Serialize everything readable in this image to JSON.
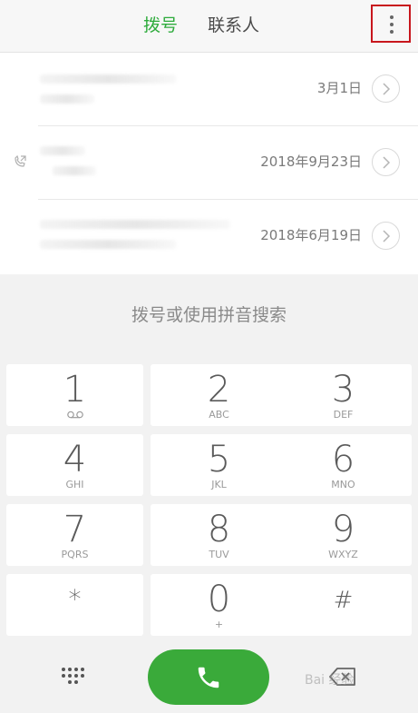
{
  "header": {
    "tab_dial": "拨号",
    "tab_contacts": "联系人",
    "menu_icon": "more-vertical-icon"
  },
  "call_log": [
    {
      "date": "3月1日",
      "call_type_icon": ""
    },
    {
      "date": "2018年9月23日",
      "call_type_icon": "outgoing-call-icon"
    },
    {
      "date": "2018年6月19日",
      "call_type_icon": ""
    }
  ],
  "search_hint": "拨号或使用拼音搜索",
  "keypad": [
    {
      "digit": "1",
      "letters": "",
      "icon": "voicemail-icon"
    },
    {
      "digit": "2",
      "letters": "ABC"
    },
    {
      "digit": "3",
      "letters": "DEF"
    },
    {
      "digit": "4",
      "letters": "GHI"
    },
    {
      "digit": "5",
      "letters": "JKL"
    },
    {
      "digit": "6",
      "letters": "MNO"
    },
    {
      "digit": "7",
      "letters": "PQRS"
    },
    {
      "digit": "8",
      "letters": "TUV"
    },
    {
      "digit": "9",
      "letters": "WXYZ"
    },
    {
      "digit": "*",
      "letters": ""
    },
    {
      "digit": "0",
      "letters": "+"
    },
    {
      "digit": "#",
      "letters": ""
    }
  ],
  "bottom_bar": {
    "left_icon": "keypad-grid-icon",
    "call_icon": "phone-icon",
    "right_icon": "backspace-icon"
  },
  "watermark": "Bai 经验",
  "colors": {
    "accent_green": "#2eab3c",
    "call_button": "#3aaa3a",
    "highlight_box": "#c8161d"
  }
}
